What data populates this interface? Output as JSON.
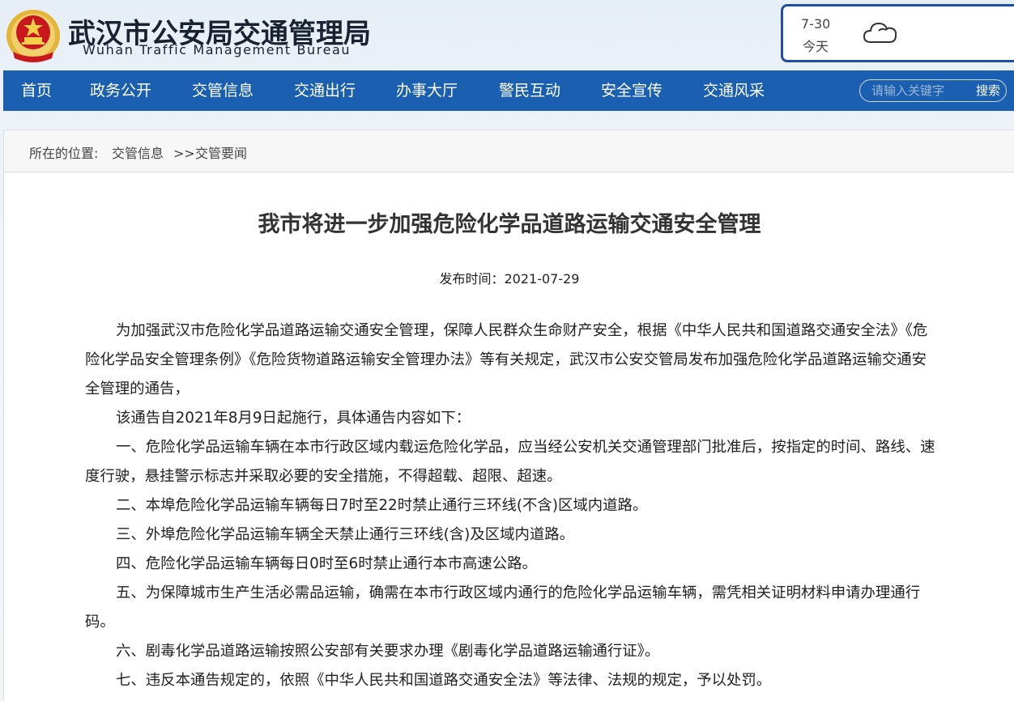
{
  "header": {
    "title_cn": "武汉市公安局交通管理局",
    "title_en": "Wuhan Traffic Management Bureau",
    "emblem_icon": "police-emblem-icon"
  },
  "weather": {
    "date": "7-30",
    "day": "今天",
    "icon": "cloud-icon"
  },
  "nav": {
    "items": [
      "首页",
      "政务公开",
      "交管信息",
      "交通出行",
      "办事大厅",
      "警民互动",
      "安全宣传",
      "交通风采"
    ],
    "search_placeholder": "请输入关键字",
    "search_button": "搜索"
  },
  "breadcrumb": {
    "prefix": "所在的位置:",
    "level1": "交管信息",
    "separator": ">>",
    "level2": "交管要闻"
  },
  "article": {
    "title": "我市将进一步加强危险化学品道路运输交通安全管理",
    "date_label": "发布时间：2021-07-29",
    "paragraphs": [
      "为加强武汉市危险化学品道路运输交通安全管理，保障人民群众生命财产安全，根据《中华人民共和国道路交通安全法》《危险化学品安全管理条例》《危险货物道路运输安全管理办法》等有关规定，武汉市公安交管局发布加强危险化学品道路运输交通安全管理的通告，",
      "该通告自2021年8月9日起施行，具体通告内容如下：",
      "一、危险化学品运输车辆在本市行政区域内载运危险化学品，应当经公安机关交通管理部门批准后，按指定的时间、路线、速度行驶，悬挂警示标志并采取必要的安全措施，不得超载、超限、超速。",
      "二、本埠危险化学品运输车辆每日7时至22时禁止通行三环线(不含)区域内道路。",
      "三、外埠危险化学品运输车辆全天禁止通行三环线(含)及区域内道路。",
      "四、危险化学品运输车辆每日0时至6时禁止通行本市高速公路。",
      "五、为保障城市生产生活必需品运输，确需在本市行政区域内通行的危险化学品运输车辆，需凭相关证明材料申请办理通行码。",
      "六、剧毒化学品道路运输按照公安部有关要求办理《剧毒化学品道路运输通行证》。",
      "七、违反本通告规定的，依照《中华人民共和国道路交通安全法》等法律、法规的规定，予以处罚。"
    ]
  },
  "colors": {
    "nav_bg": "#1a5fb0",
    "weather_border": "#1f4fa3",
    "emblem_red": "#c8171d",
    "emblem_gold": "#e3b63a"
  }
}
